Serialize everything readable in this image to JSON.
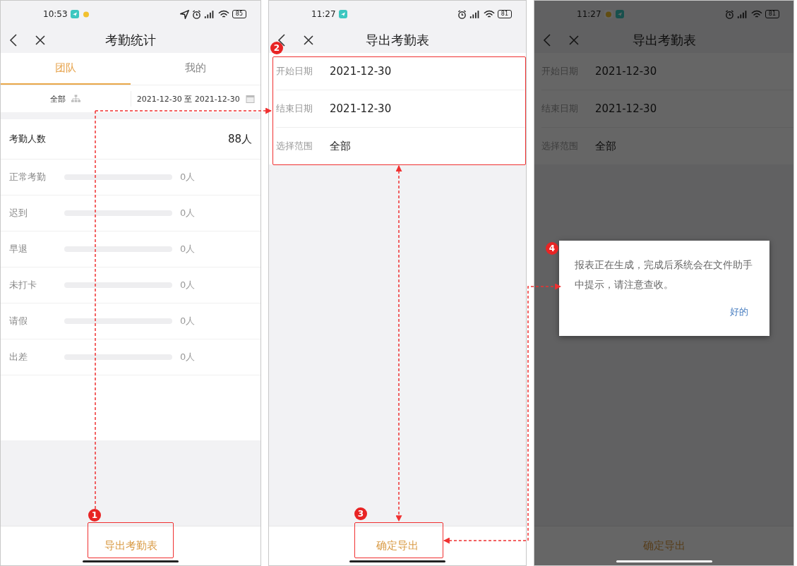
{
  "screens": [
    {
      "kind": "stats",
      "status_bar": {
        "time": "10:53",
        "location": true,
        "battery": "85"
      },
      "title": "考勤统计",
      "tabs": [
        {
          "label": "团队",
          "selected": true
        },
        {
          "label": "我的",
          "selected": false
        }
      ],
      "filters": {
        "scope": "全部",
        "date_range": "2021-12-30 至 2021-12-30"
      },
      "total": {
        "label": "考勤人数",
        "value": "88人"
      },
      "rows": [
        {
          "label": "正常考勤",
          "value": "0人"
        },
        {
          "label": "迟到",
          "value": "0人"
        },
        {
          "label": "早退",
          "value": "0人"
        },
        {
          "label": "未打卡",
          "value": "0人"
        },
        {
          "label": "请假",
          "value": "0人"
        },
        {
          "label": "出差",
          "value": "0人"
        }
      ],
      "footer_button": "导出考勤表"
    },
    {
      "kind": "form",
      "status_bar": {
        "time": "11:27",
        "location": false,
        "battery": "81"
      },
      "title": "导出考勤表",
      "fields": [
        {
          "label": "开始日期",
          "value": "2021-12-30"
        },
        {
          "label": "结束日期",
          "value": "2021-12-30"
        },
        {
          "label": "选择范围",
          "value": "全部"
        }
      ],
      "footer_button": "确定导出"
    },
    {
      "kind": "dialog",
      "status_bar": {
        "time": "11:27",
        "location": false,
        "battery": "81"
      },
      "title": "导出考勤表",
      "fields": [
        {
          "label": "开始日期",
          "value": "2021-12-30"
        },
        {
          "label": "结束日期",
          "value": "2021-12-30"
        },
        {
          "label": "选择范围",
          "value": "全部"
        }
      ],
      "footer_button": "确定导出",
      "dialog": {
        "message": "报表正在生成，完成后系统会在文件助手中提示，请注意查收。",
        "button": "好的"
      }
    }
  ],
  "annotations": [
    {
      "number": "1"
    },
    {
      "number": "2"
    },
    {
      "number": "3"
    },
    {
      "number": "4"
    }
  ]
}
